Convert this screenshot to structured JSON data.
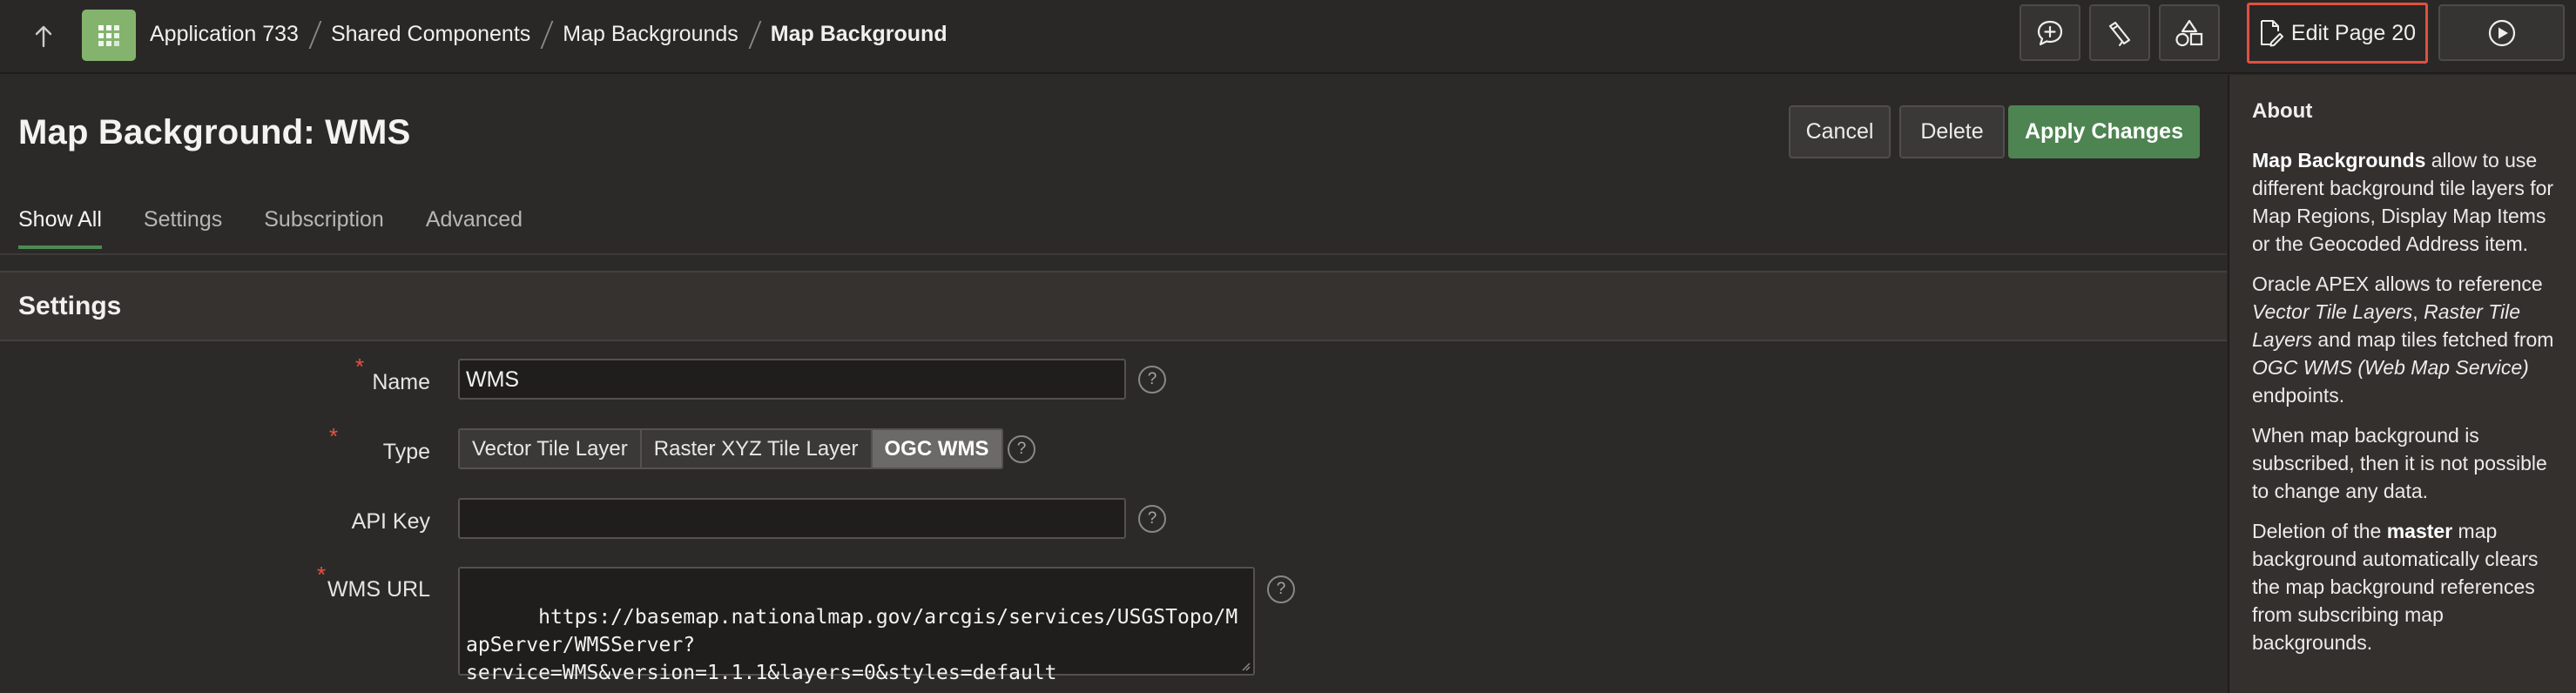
{
  "header": {
    "breadcrumbs": [
      "Application 733",
      "Shared Components",
      "Map Backgrounds",
      "Map Background"
    ],
    "edit_page_label": "Edit Page 20"
  },
  "page": {
    "title": "Map Background: WMS",
    "buttons": {
      "cancel": "Cancel",
      "delete": "Delete",
      "apply": "Apply Changes"
    },
    "tabs": [
      "Show All",
      "Settings",
      "Subscription",
      "Advanced"
    ],
    "active_tab": "Show All"
  },
  "settings": {
    "section_title": "Settings",
    "name": {
      "label": "Name",
      "value": "WMS",
      "required": true
    },
    "type": {
      "label": "Type",
      "options": [
        "Vector Tile Layer",
        "Raster XYZ Tile Layer",
        "OGC WMS"
      ],
      "selected": "OGC WMS",
      "required": true
    },
    "api_key": {
      "label": "API Key",
      "value": ""
    },
    "wms_url": {
      "label": "WMS URL",
      "value": "https://basemap.nationalmap.gov/arcgis/services/USGSTopo/MapServer/WMSServer?\nservice=WMS&version=1.1.1&layers=0&styles=default",
      "required": true
    },
    "help_glyph": "?"
  },
  "about": {
    "title": "About",
    "p1_bold": "Map Backgrounds",
    "p1_rest": " allow to use different background tile layers for Map Regions, Display Map Items or the Geocoded Address item.",
    "p2_a": "Oracle APEX allows to reference ",
    "p2_i1": "Vector Tile Layers",
    "p2_b": ", ",
    "p2_i2": "Raster Tile Layers",
    "p2_c": " and map tiles fetched from ",
    "p2_i3": "OGC WMS (Web Map Service)",
    "p2_d": " endpoints.",
    "p3": "When map background is subscribed, then it is not possible to change any data.",
    "p4_a": "Deletion of the ",
    "p4_bold": "master",
    "p4_b": " map background automatically clears the map background references from subscribing map backgrounds."
  },
  "colors": {
    "accent_green": "#4e8451",
    "app_icon": "#84b36e",
    "highlight_red": "#e05040"
  }
}
